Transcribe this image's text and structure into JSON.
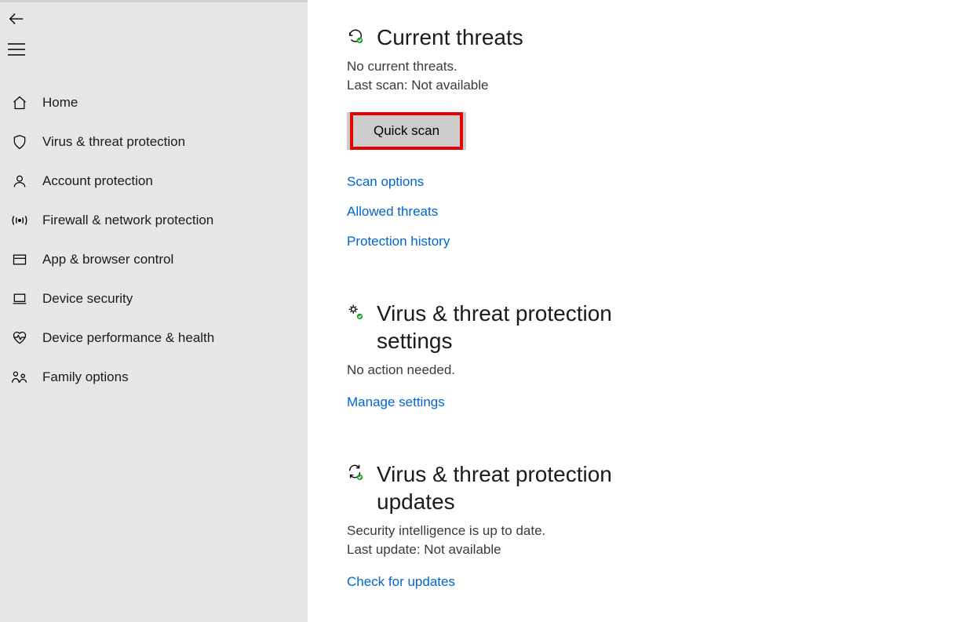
{
  "sidebar": {
    "items": [
      {
        "label": "Home"
      },
      {
        "label": "Virus & threat protection"
      },
      {
        "label": "Account protection"
      },
      {
        "label": "Firewall & network protection"
      },
      {
        "label": "App & browser control"
      },
      {
        "label": "Device security"
      },
      {
        "label": "Device performance & health"
      },
      {
        "label": "Family options"
      }
    ]
  },
  "threats": {
    "title": "Current threats",
    "status": "No current threats.",
    "last_scan": "Last scan: Not available",
    "quick_scan_label": "Quick scan",
    "links": {
      "scan_options": "Scan options",
      "allowed_threats": "Allowed threats",
      "protection_history": "Protection history"
    }
  },
  "settings": {
    "title": "Virus & threat protection settings",
    "status": "No action needed.",
    "manage_link": "Manage settings"
  },
  "updates": {
    "title": "Virus & threat protection updates",
    "status": "Security intelligence is up to date.",
    "last_update": "Last update: Not available",
    "check_link": "Check for updates"
  }
}
